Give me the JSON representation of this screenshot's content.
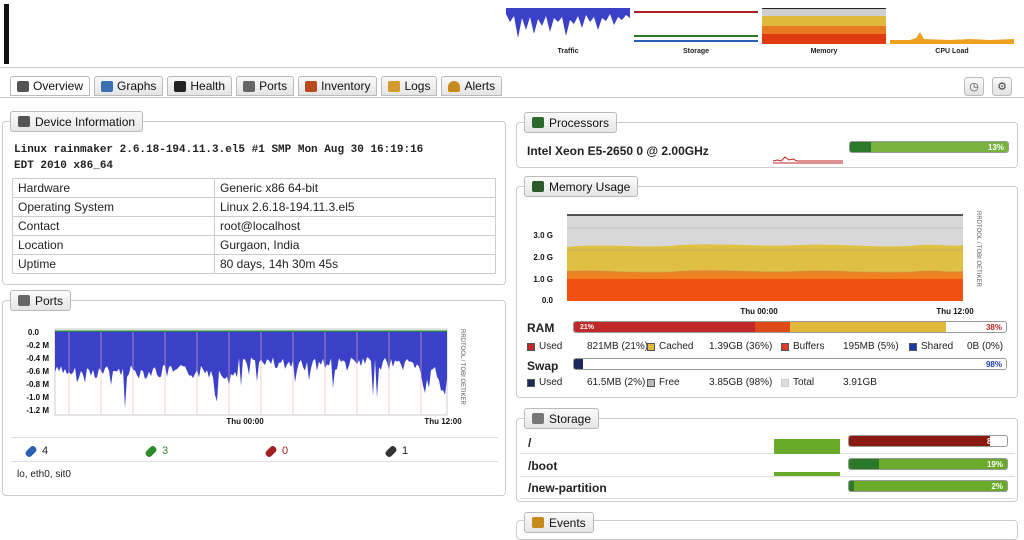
{
  "mini_graphs": [
    {
      "label": "Traffic",
      "icon": "traffic-graph"
    },
    {
      "label": "Storage",
      "icon": "storage-graph"
    },
    {
      "label": "Memory",
      "icon": "memory-graph"
    },
    {
      "label": "CPU Load",
      "icon": "cpu-load-graph"
    }
  ],
  "tabs": [
    {
      "label": "Overview",
      "icon": "monitor-icon",
      "color": "#555"
    },
    {
      "label": "Graphs",
      "icon": "graphs-icon",
      "color": "#3a6fb0"
    },
    {
      "label": "Health",
      "icon": "health-icon",
      "color": "#222"
    },
    {
      "label": "Ports",
      "icon": "ports-icon",
      "color": "#666"
    },
    {
      "label": "Inventory",
      "icon": "inventory-icon",
      "color": "#b84a1c"
    },
    {
      "label": "Logs",
      "icon": "logs-icon",
      "color": "#d39a2e"
    },
    {
      "label": "Alerts",
      "icon": "bell-icon",
      "color": "#c98a1c"
    }
  ],
  "device_info": {
    "title": "Device Information",
    "description_line1": "Linux rainmaker 2.6.18-194.11.3.el5 #1 SMP Mon Aug 30 16:19:16",
    "description_line2": "EDT 2010 x86_64",
    "rows": [
      {
        "key": "Hardware",
        "value": "Generic x86 64-bit"
      },
      {
        "key": "Operating System",
        "value": "Linux 2.6.18-194.11.3.el5"
      },
      {
        "key": "Contact",
        "value": "root@localhost"
      },
      {
        "key": "Location",
        "value": "Gurgaon, India"
      },
      {
        "key": "Uptime",
        "value": "80 days, 14h 30m 45s"
      }
    ]
  },
  "ports": {
    "title": "Ports",
    "graph": {
      "y_ticks": [
        "0.0",
        "-0.2 M",
        "-0.4 M",
        "-0.6 M",
        "-0.8 M",
        "-1.0 M",
        "-1.2 M"
      ],
      "x_ticks": [
        "Thu 00:00",
        "Thu 12:00"
      ],
      "watermark": "RRDTOOL / TOBI OETIKER"
    },
    "counts": [
      {
        "value": "4",
        "color": "#2a5fb5"
      },
      {
        "value": "3",
        "color": "#2d8a2d"
      },
      {
        "value": "0",
        "color": "#a02020"
      },
      {
        "value": "1",
        "color": "#333333"
      }
    ],
    "port_list": "lo, eth0, sit0"
  },
  "processors": {
    "title": "Processors",
    "name": "Intel Xeon E5-2650 0 @ 2.00GHz",
    "usage_pct": 13,
    "usage_label": "13%"
  },
  "memory": {
    "title": "Memory Usage",
    "graph": {
      "y_ticks": [
        "3.0 G",
        "2.0 G",
        "1.0 G",
        "0.0"
      ],
      "x_ticks": [
        "Thu 00:00",
        "Thu 12:00"
      ],
      "watermark": "RRDTOOL / TOBI OETIKER"
    },
    "ram": {
      "label": "RAM",
      "used_pct": 21,
      "used_label": "21%",
      "buffers_pct": 5,
      "cached_pct": 36,
      "total_label": "38%",
      "legend": [
        {
          "name": "Used",
          "value": "821MB (21%)",
          "color": "#c0282a"
        },
        {
          "name": "Cached",
          "value": "1.39GB (36%)",
          "color": "#e0b83a"
        },
        {
          "name": "Buffers",
          "value": "195MB (5%)",
          "color": "#e03a2a"
        },
        {
          "name": "Shared",
          "value": "0B (0%)",
          "color": "#1a3aa8"
        }
      ]
    },
    "swap": {
      "label": "Swap",
      "used_pct": 2,
      "free_label": "98%",
      "legend": [
        {
          "name": "Used",
          "value": "61.5MB (2%)",
          "color": "#1a2a5a"
        },
        {
          "name": "Free",
          "value": "3.85GB (98%)",
          "color": "#bbbbbb"
        },
        {
          "name": "Total",
          "value": "3.91GB",
          "color": "#dddddd"
        }
      ]
    }
  },
  "storage": {
    "title": "Storage",
    "items": [
      {
        "mount": "/",
        "pct": 89,
        "label": "89%",
        "color": "#8b1a10"
      },
      {
        "mount": "/boot",
        "pct": 19,
        "label": "19%",
        "color": "#5aa020"
      },
      {
        "mount": "/new-partition",
        "pct": 2,
        "label": "2%",
        "color": "#5aa020"
      }
    ]
  },
  "events": {
    "title": "Events"
  }
}
